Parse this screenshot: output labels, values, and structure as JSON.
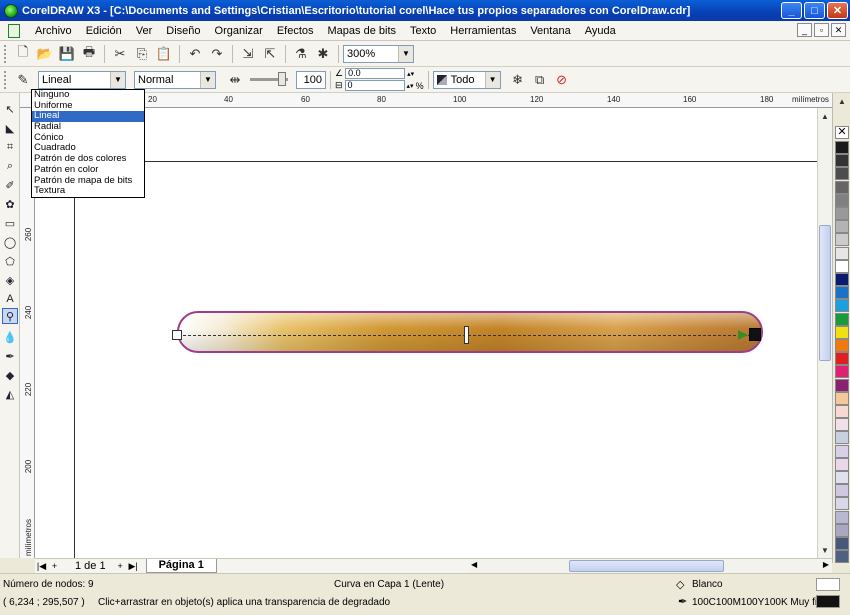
{
  "window": {
    "title": "CorelDRAW X3 - [C:\\Documents and Settings\\Cristian\\Escritorio\\tutorial corel\\Hace tus propios separadores con CorelDraw.cdr]",
    "minimize": "_",
    "maximize": "□",
    "close": "✕"
  },
  "menu": {
    "items": [
      "Archivo",
      "Edición",
      "Ver",
      "Diseño",
      "Organizar",
      "Efectos",
      "Mapas de bits",
      "Texto",
      "Herramientas",
      "Ventana",
      "Ayuda"
    ],
    "mdi_min": "_",
    "mdi_restore": "▫",
    "mdi_close": "✕"
  },
  "toolbar1": {
    "zoom": "300%"
  },
  "toolbar2": {
    "transparency_type": "Lineal",
    "merge_mode": "Normal",
    "opacity": "100",
    "angle": "0.0",
    "edge_pad": "0",
    "edge_unit": "%",
    "target": "Todo"
  },
  "dropdown": {
    "options": [
      "Ninguno",
      "Uniforme",
      "Lineal",
      "Radial",
      "Cónico",
      "Cuadrado",
      "Patrón de dos colores",
      "Patrón en color",
      "Patrón de mapa de bits",
      "Textura"
    ],
    "selected_index": 2
  },
  "ruler": {
    "h_ticks": [
      "20",
      "40",
      "60",
      "80",
      "100",
      "120",
      "140",
      "160",
      "180"
    ],
    "h_unit": "milímetros",
    "v_ticks": [
      "260",
      "240",
      "220",
      "200"
    ],
    "v_unit": "milímetros"
  },
  "pagenav": {
    "page_count": "1 de 1",
    "page_tab": "Página 1"
  },
  "status": {
    "nodes": "Número de nodos: 9",
    "object": "Curva en Capa 1  (Lente)",
    "coords": "( 6,234 ; 295,507 )",
    "hint": "Clic+arrastrar en objeto(s) aplica una transparencia de degradado",
    "fill_name": "Blanco",
    "outline_desc": "100C100M100Y100K  Muy fina"
  },
  "palette_colors": [
    "#1a1a1a",
    "#333333",
    "#4d4d4d",
    "#666666",
    "#808080",
    "#999999",
    "#b3b3b3",
    "#cccccc",
    "#e6e6e6",
    "#ffffff",
    "#0a1a6e",
    "#1a72c8",
    "#1aa0e0",
    "#1a9a3a",
    "#f0e010",
    "#f07a10",
    "#e02020",
    "#e02070",
    "#8a2070",
    "#f4c898",
    "#f8d8d0",
    "#f0e0e8",
    "#c8d0e0",
    "#d8d0e8",
    "#e8d8e8",
    "#e0e0f0",
    "#d0c8e0",
    "#d8d8e8",
    "#b8b8d0",
    "#a8a8c0",
    "#48587a",
    "#506080"
  ]
}
